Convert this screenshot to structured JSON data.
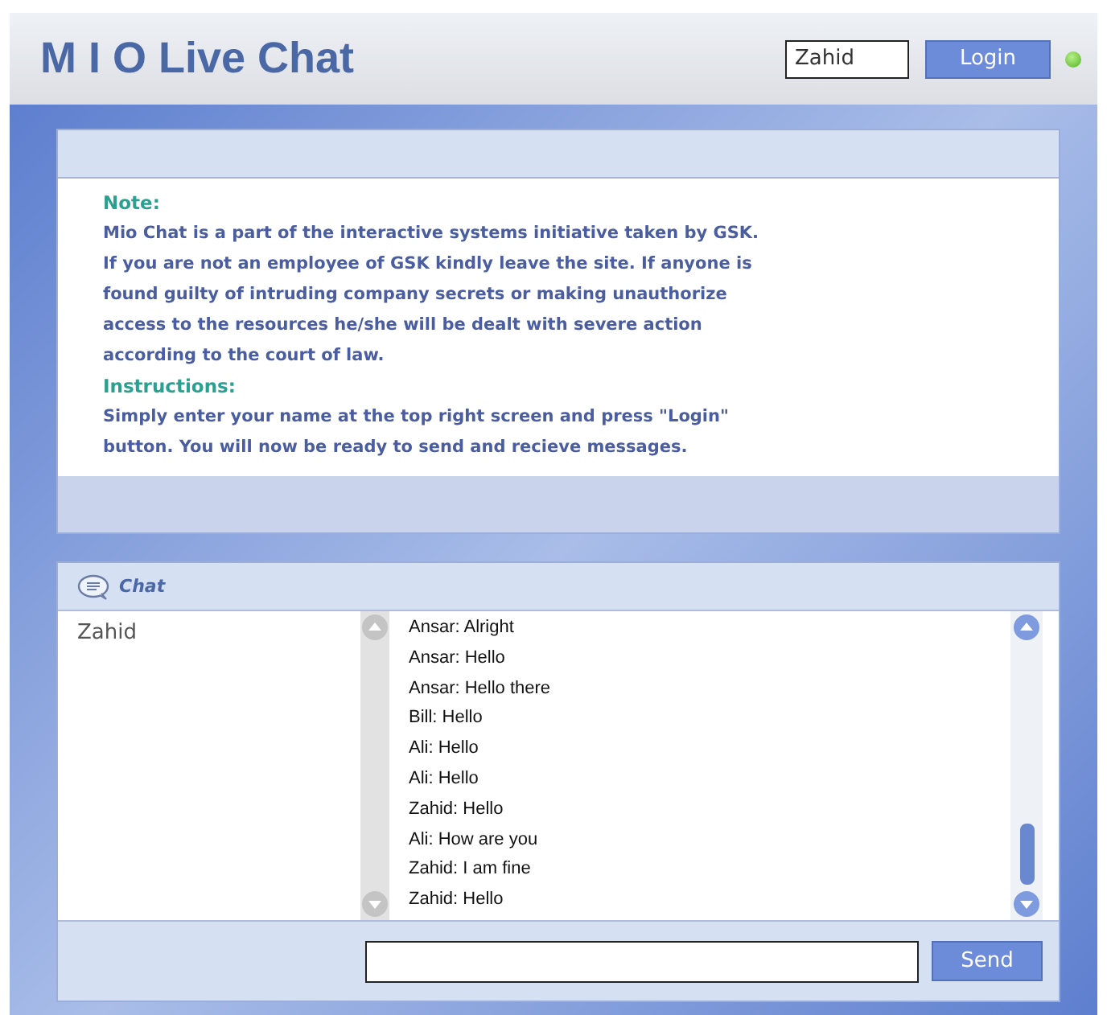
{
  "header": {
    "title": "M I O Live Chat",
    "name_field": {
      "value": "Zahid"
    },
    "login_button": "Login",
    "online": true
  },
  "notice": {
    "sections": [
      {
        "heading": "Note:",
        "lines": [
          "Mio Chat is a part of the interactive systems initiative taken by GSK.",
          "If you are not an employee of GSK kindly leave the site. If anyone is",
          "found guilty of intruding company secrets or making unauthorize",
          "access to the resources he/she will be dealt with severe action",
          "according to the court of law."
        ]
      },
      {
        "heading": "Instructions:",
        "lines": [
          "Simply enter your name at the top right screen and press \"Login\"",
          "button. You will now be ready to send and recieve messages."
        ]
      }
    ]
  },
  "chat": {
    "title": "Chat",
    "users": [
      "Zahid"
    ],
    "messages": [
      "Ansar: Alright",
      "Ansar: Hello",
      "Ansar: Hello there",
      "Bill: Hello",
      "Ali: Hello",
      "Ali: Hello",
      "Zahid: Hello",
      "Ali: How are you",
      "Zahid: I am fine",
      "Zahid: Hello"
    ],
    "send_button": "Send"
  }
}
